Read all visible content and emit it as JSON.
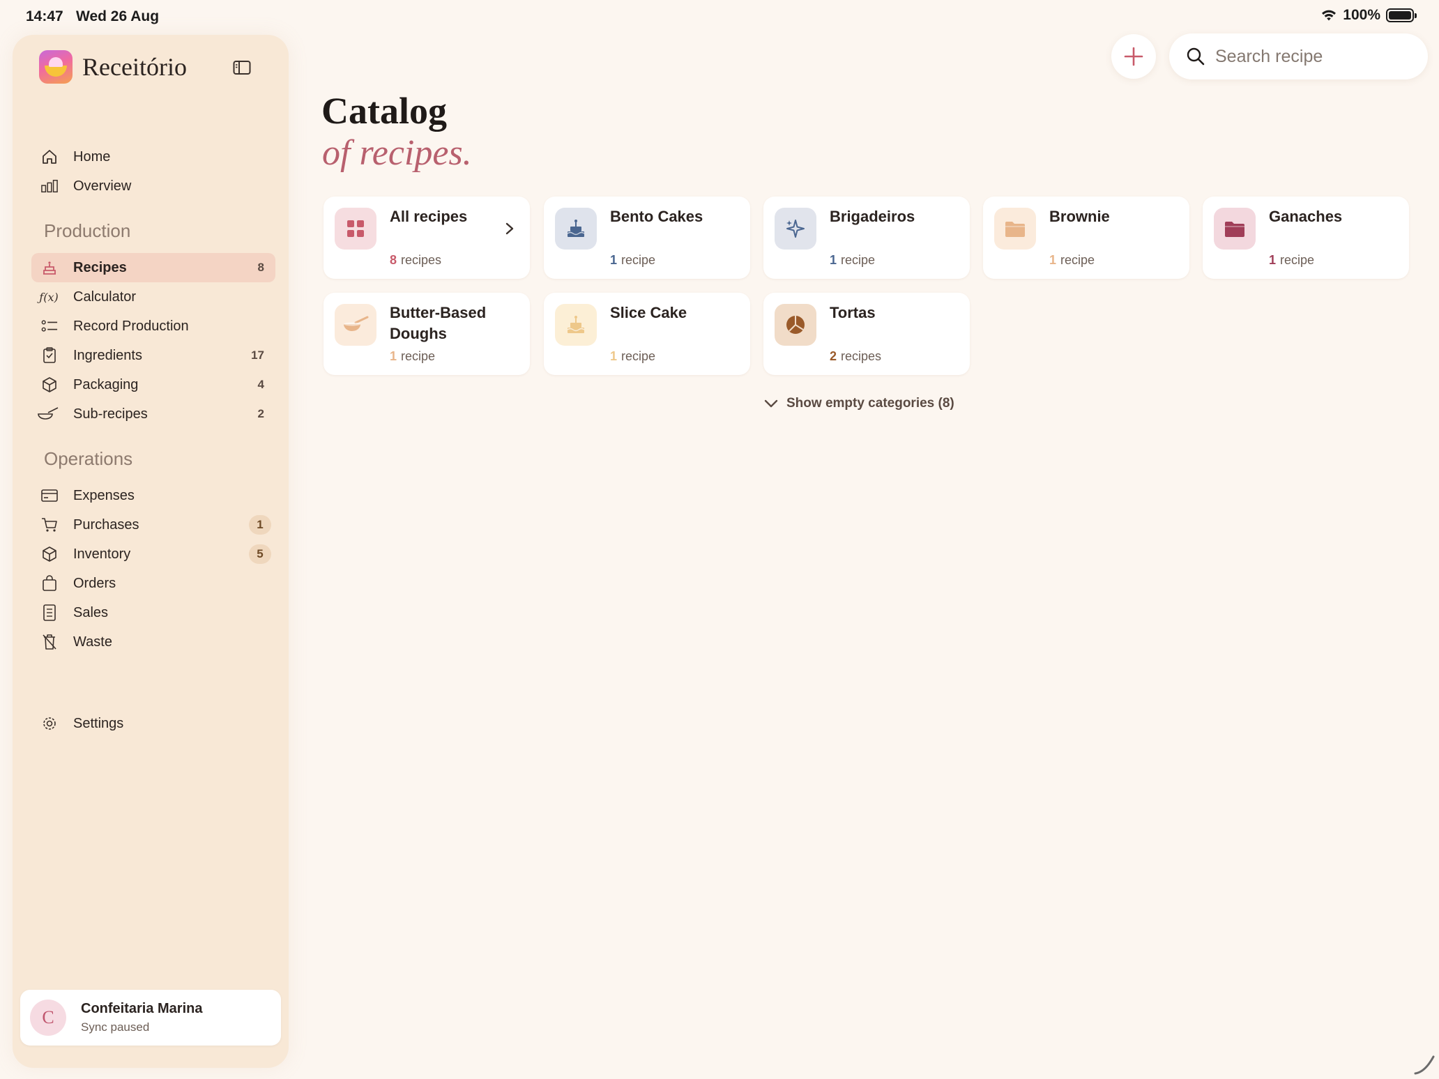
{
  "status_bar": {
    "time": "14:47",
    "date": "Wed 26 Aug",
    "battery": "100%"
  },
  "sidebar": {
    "app_name": "Receitório",
    "top_items": [
      {
        "label": "Home",
        "icon": "house-icon"
      },
      {
        "label": "Overview",
        "icon": "bar-chart-icon"
      }
    ],
    "production": {
      "title": "Production",
      "items": [
        {
          "label": "Recipes",
          "count": "8",
          "active": true
        },
        {
          "label": "Calculator",
          "count": ""
        },
        {
          "label": "Record Production",
          "count": ""
        },
        {
          "label": "Ingredients",
          "count": "17"
        },
        {
          "label": "Packaging",
          "count": "4"
        },
        {
          "label": "Sub-recipes",
          "count": "2"
        }
      ]
    },
    "operations": {
      "title": "Operations",
      "items": [
        {
          "label": "Expenses",
          "count": ""
        },
        {
          "label": "Purchases",
          "badge": "1"
        },
        {
          "label": "Inventory",
          "badge": "5"
        },
        {
          "label": "Orders",
          "count": ""
        },
        {
          "label": "Sales",
          "count": ""
        },
        {
          "label": "Waste",
          "count": ""
        }
      ]
    },
    "settings_label": "Settings",
    "user": {
      "initial": "C",
      "name": "Confeitaria Marina",
      "status": "Sync paused"
    }
  },
  "search": {
    "placeholder": "Search recipe",
    "value": ""
  },
  "header": {
    "title": "Catalog",
    "subtitle": "of recipes."
  },
  "categories": [
    {
      "name": "All recipes",
      "count": "8",
      "unit": "recipes",
      "icon": "grid-icon",
      "icon_bg": "#f6dde0",
      "accent": "#c85a6a"
    },
    {
      "name": "Bento Cakes",
      "count": "1",
      "unit": "recipe",
      "icon": "cake-icon",
      "icon_bg": "#dfe3ec",
      "accent": "#4a6690"
    },
    {
      "name": "Brigadeiros",
      "count": "1",
      "unit": "recipe",
      "icon": "sparkles-icon",
      "icon_bg": "#e1e4ec",
      "accent": "#4a6690"
    },
    {
      "name": "Brownie",
      "count": "1",
      "unit": "recipe",
      "icon": "folder-icon",
      "icon_bg": "#fbebdc",
      "accent": "#e8b58a"
    },
    {
      "name": "Ganaches",
      "count": "1",
      "unit": "recipe",
      "icon": "folder-icon",
      "icon_bg": "#f3d8de",
      "accent": "#a03e58"
    },
    {
      "name": "Butter-Based Doughs",
      "count": "1",
      "unit": "recipe",
      "icon": "bowl-icon",
      "icon_bg": "#fbebdc",
      "accent": "#e8b58a"
    },
    {
      "name": "Slice Cake",
      "count": "1",
      "unit": "recipe",
      "icon": "cake-icon",
      "icon_bg": "#fcefd6",
      "accent": "#eec88a"
    },
    {
      "name": "Tortas",
      "count": "2",
      "unit": "recipes",
      "icon": "pie-icon",
      "icon_bg": "#f1dcc8",
      "accent": "#9a5a2a"
    }
  ],
  "show_empty_label": "Show empty categories (8)"
}
